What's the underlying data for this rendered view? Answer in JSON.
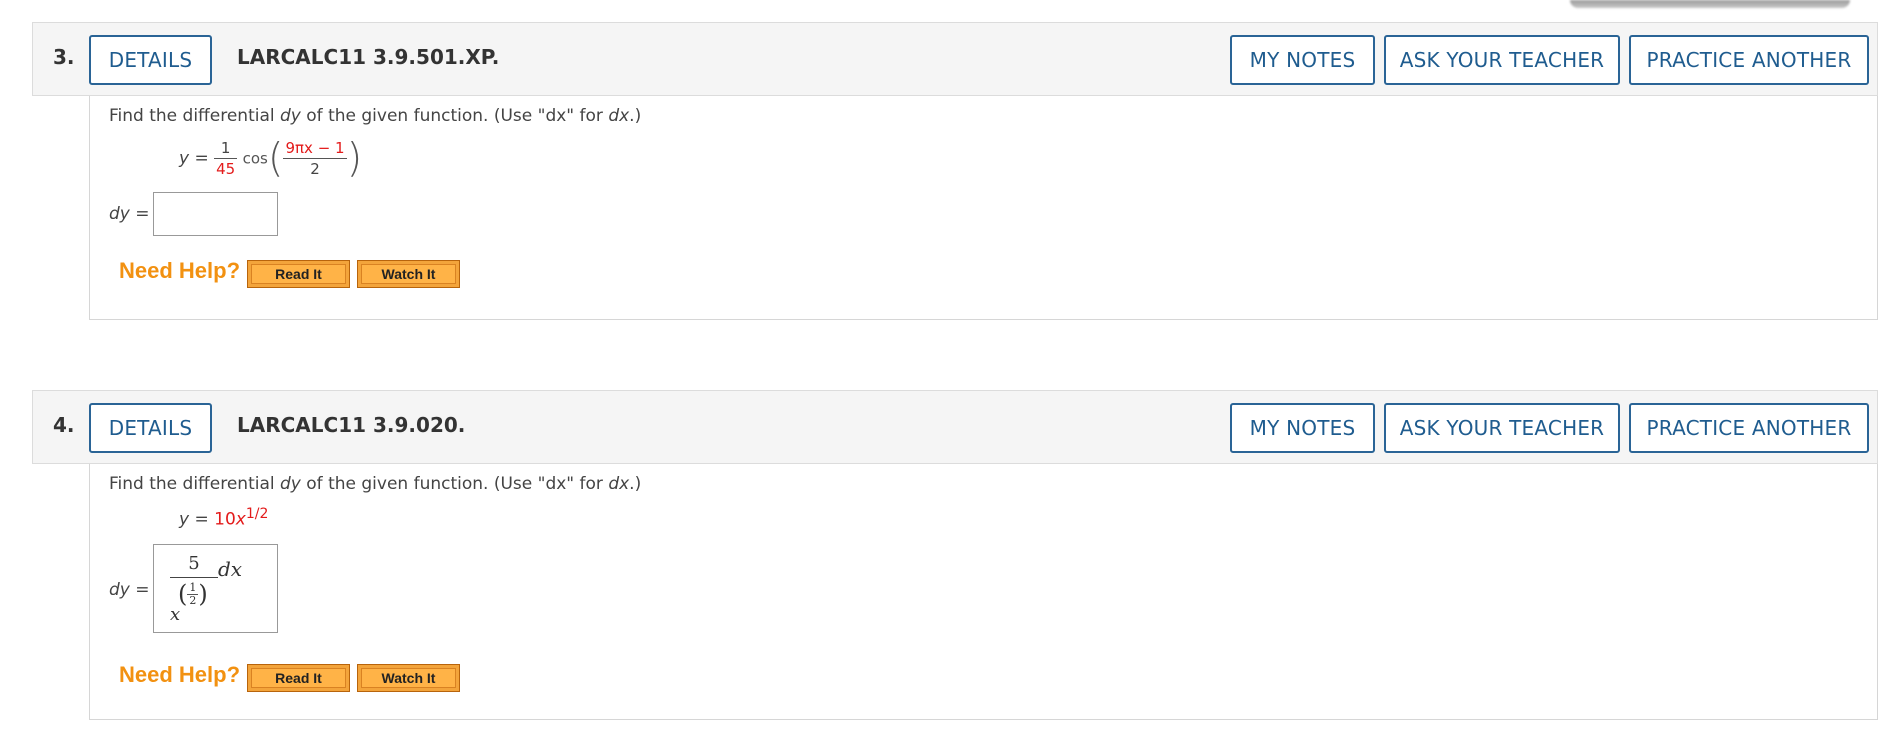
{
  "questions": [
    {
      "number": "3.",
      "details_label": "DETAILS",
      "code": "LARCALC11 3.9.501.XP.",
      "my_notes": "MY NOTES",
      "ask_teacher": "ASK YOUR TEACHER",
      "practice_another": "PRACTICE ANOTHER",
      "prompt_pre": "Find the differential ",
      "prompt_var": "dy",
      "prompt_mid": " of the given function. (Use \"dx\" for ",
      "prompt_dx": "dx",
      "prompt_end": ".)",
      "eq_lhs": "y =",
      "frac_num": "1",
      "frac_den": "45",
      "func": "cos",
      "arg_num": "9πx − 1",
      "arg_den": "2",
      "dy_label": "dy =",
      "answer_value": "",
      "need_help": "Need Help?",
      "read_it": "Read It",
      "watch_it": "Watch It"
    },
    {
      "number": "4.",
      "details_label": "DETAILS",
      "code": "LARCALC11 3.9.020.",
      "my_notes": "MY NOTES",
      "ask_teacher": "ASK YOUR TEACHER",
      "practice_another": "PRACTICE ANOTHER",
      "prompt_pre": "Find the differential ",
      "prompt_var": "dy",
      "prompt_mid": " of the given function. (Use \"dx\" for ",
      "prompt_dx": "dx",
      "prompt_end": ".)",
      "eq_lhs": "y =",
      "eq_coef": "10",
      "eq_var": "x",
      "eq_exp": "1/2",
      "dy_label": "dy =",
      "answer": {
        "numerator": "5",
        "denominator_base": "x",
        "exponent_num": "1",
        "exponent_den": "2",
        "suffix": "dx"
      },
      "need_help": "Need Help?",
      "read_it": "Read It",
      "watch_it": "Watch It"
    }
  ]
}
